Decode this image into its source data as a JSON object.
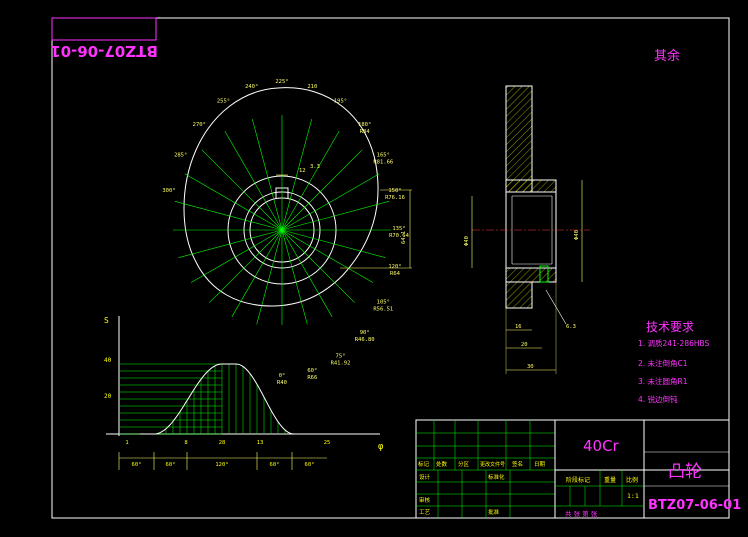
{
  "drawing_number_mirrored": "BTZ07-06-01",
  "remaining_note": "其余",
  "tech_requirements": {
    "title": "技术要求",
    "items": [
      "1. 调质241-286HBS",
      "2. 未注倒角C1",
      "3. 未注圆角R1",
      "4. 锐边倒钝"
    ]
  },
  "title_block": {
    "material": "40Cr",
    "part_name": "凸轮",
    "drawing_number": "BTZ07-06-01",
    "scale_label": "比例",
    "scale": "1:1",
    "weight_label": "重量",
    "stage_label": "阶段标记",
    "row_labels": [
      "标记",
      "处数",
      "分区",
      "更改文件号",
      "签名",
      "日期"
    ],
    "side_labels": [
      "设计",
      "审核",
      "工艺"
    ],
    "std_label": "标准化",
    "approve_label": "批准",
    "sheet_label": "共 张 第 张"
  },
  "cam_view": {
    "angle_labels": [
      {
        "ang": "0°",
        "val": "R40"
      },
      {
        "ang": "60°",
        "val": "R66"
      },
      {
        "ang": "75°",
        "val": "R41.92"
      },
      {
        "ang": "90°",
        "val": "R46.80"
      },
      {
        "ang": "105°",
        "val": "R56.51"
      },
      {
        "ang": "120°",
        "val": "R64"
      },
      {
        "ang": "135°",
        "val": "R70.64"
      },
      {
        "ang": "150°",
        "val": "R76.16"
      },
      {
        "ang": "165°",
        "val": "R81.66"
      },
      {
        "ang": "180°",
        "val": "R84"
      },
      {
        "ang": "195°",
        "val": ""
      },
      {
        "ang": "210",
        "val": ""
      },
      {
        "ang": "225°",
        "val": ""
      },
      {
        "ang": "240°",
        "val": ""
      },
      {
        "ang": "255°",
        "val": ""
      },
      {
        "ang": "270°",
        "val": ""
      },
      {
        "ang": "285°",
        "val": ""
      },
      {
        "ang": "300°",
        "val": ""
      }
    ],
    "keyway_width": "12",
    "keyway_depth": "3.3",
    "vertical_dim": "64.1"
  },
  "section_view": {
    "bore_dim": "Φ40",
    "hub_dim": "Φ40",
    "width_1": "16",
    "width_2": "20",
    "width_3": "30",
    "roughness": "6.3"
  },
  "displacement_chart": {
    "y_axis_label": "S",
    "x_axis_label": "φ",
    "y_ticks": [
      "40",
      "20"
    ],
    "x_ticks": [
      "1",
      "8",
      "28",
      "13",
      "25"
    ],
    "segments": [
      "60°",
      "60°",
      "120°",
      "60°",
      "60°"
    ]
  }
}
